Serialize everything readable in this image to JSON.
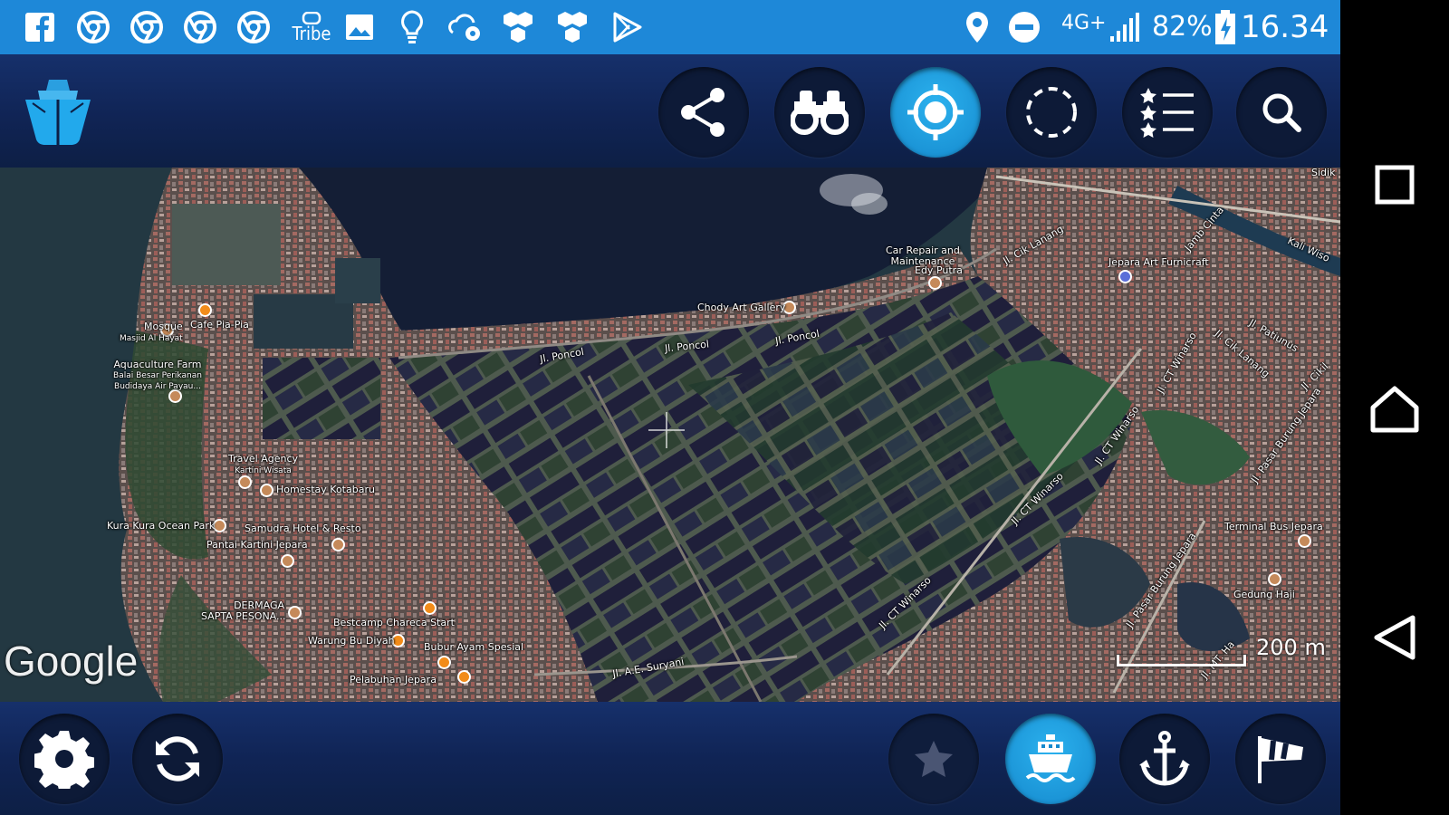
{
  "status_bar": {
    "left_icons": [
      "facebook-icon",
      "chrome-icon",
      "chrome-icon",
      "chrome-icon",
      "chrome-icon",
      "tribe-icon",
      "gallery-icon",
      "lightbulb-icon",
      "cloud-settings-icon",
      "hexagons-icon",
      "hexagons-icon",
      "play-store-icon"
    ],
    "tribe_label": "Tribe",
    "network": "4G+",
    "battery": "82%",
    "time": "16.34"
  },
  "toolbar": {
    "buttons": [
      "share",
      "binoculars",
      "my-location",
      "area-select",
      "favorites-list",
      "search"
    ],
    "active": "my-location",
    "accent_color": "#1a9ae0"
  },
  "map": {
    "labels": [
      {
        "text": "Mosque",
        "sub": "Masjid Al Hayat"
      },
      {
        "text": "Cafe Pia-Pia"
      },
      {
        "text": "Aquaculture Farm",
        "sub": "Balai Besar Perikanan Budidaya Air Payau..."
      },
      {
        "text": "Travel Agency",
        "sub": "Kartini Wisata"
      },
      {
        "text": "Homestay Kotabaru"
      },
      {
        "text": "Kura Kura Ocean Park"
      },
      {
        "text": "Samudra Hotel & Resto"
      },
      {
        "text": "Pantai Kartini Jepara"
      },
      {
        "text": "DERMAGA",
        "sub": "SAPTA PESONA..."
      },
      {
        "text": "Bestcamp Chareca Start"
      },
      {
        "text": "Warung Bu Diyah"
      },
      {
        "text": "Bubur Ayam Spesial"
      },
      {
        "text": "Pelabuhan Jepara"
      },
      {
        "text": "Jl. A.E. Suryani"
      },
      {
        "text": "Jl. Poncol"
      },
      {
        "text": "Jl. Poncol"
      },
      {
        "text": "Jl. Poncol"
      },
      {
        "text": "Chody Art Gallery"
      },
      {
        "text": "Car Repair and",
        "sub": "Maintenance"
      },
      {
        "text": "Edy Putra"
      },
      {
        "text": "Jl. Cik Lanang"
      },
      {
        "text": "Jepara Art Furnicraft"
      },
      {
        "text": "Jl. Patiunus"
      },
      {
        "text": "Jl. Cik Lanang"
      },
      {
        "text": "Jl. CT Winarso"
      },
      {
        "text": "Jl. CT Winarso"
      },
      {
        "text": "Jl. CT Winarso"
      },
      {
        "text": "Jl. CT Winarso"
      },
      {
        "text": "Jl. Pasar Burung Jepara"
      },
      {
        "text": "Jl. Pasar Burung Jepara"
      },
      {
        "text": "Terminal Bus Jepara"
      },
      {
        "text": "Gedung Haji"
      },
      {
        "text": "Jamb Cinta"
      },
      {
        "text": "Kali Wiso"
      },
      {
        "text": "Jl. Cikil"
      },
      {
        "text": "Jl. MT. Ha"
      },
      {
        "text": "Sidik"
      }
    ],
    "google_logo": "Google",
    "scale": "200 m"
  },
  "bottom_bar": {
    "buttons": [
      "settings",
      "refresh",
      "favorite",
      "ship",
      "anchor",
      "windsock"
    ],
    "active": "ship"
  },
  "nav_bar": {
    "buttons": [
      "recents",
      "home",
      "back"
    ]
  }
}
